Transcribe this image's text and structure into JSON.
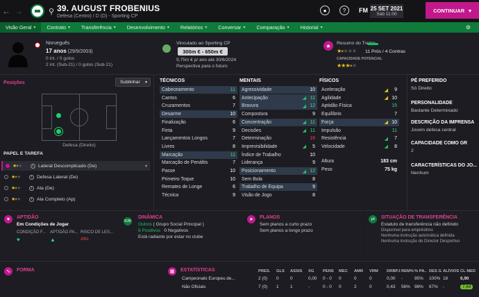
{
  "header": {
    "title": "39. AUGUST FROBENIUS",
    "subtitle": "Defesa (Centro) / D (D) - Sporting CP",
    "date": "25 SET 2021",
    "time": "Sáb 11:00",
    "continue": "CONTINUAR",
    "fm": "FM"
  },
  "tabs": [
    "Visão Geral",
    "Contrato",
    "Transferência",
    "Desenvolvimento",
    "Relatórios",
    "Conversar",
    "Comparação",
    "Historial"
  ],
  "profile": {
    "nationality": "Norueguês",
    "age": "17 anos",
    "dob": "(29/9/2003)",
    "caps1": "0 int. / 0 golos",
    "caps2": "2 int. (Sub-21) / 0 golos (Sub-21)"
  },
  "contract": {
    "label": "Vinculado ao Sporting CP",
    "value": "300m € - 650m €",
    "details": "9,75m € p/ ano até 30/6/2024",
    "perspective": "Perspectiva para o futuro"
  },
  "training": {
    "title": "Resumo do Treino",
    "pros": "11 Prós / 4 Contras",
    "cap_label": "CAPACIDADE POTENCIAL"
  },
  "positions": {
    "title": "Posições",
    "select": "Sublinhar",
    "pitch_label": "Defesa (Direito)"
  },
  "roles": {
    "title": "PAPEL E TAREFA",
    "items": [
      "Lateral Descomplicado (De)",
      "Defesa Lateral (De)",
      "Ala (De)",
      "Ala Completo (Ap)"
    ]
  },
  "tecnicos": {
    "title": "TÉCNICOS",
    "rows": [
      [
        "Cabeceamento",
        "11"
      ],
      [
        "Cantos",
        "6"
      ],
      [
        "Cruzamentos",
        "7"
      ],
      [
        "Desarme",
        "10"
      ],
      [
        "Finalização",
        "6"
      ],
      [
        "Finta",
        "9"
      ],
      [
        "Lançamentos Longos",
        "7"
      ],
      [
        "Livres",
        "8"
      ],
      [
        "Marcação",
        "11"
      ],
      [
        "Marcação de Penáltis",
        "7"
      ],
      [
        "Passe",
        "10"
      ],
      [
        "Primeiro Toque",
        "10"
      ],
      [
        "Remates de Longe",
        "6"
      ],
      [
        "Técnica",
        "9"
      ]
    ]
  },
  "mentais": {
    "title": "MENTAIS",
    "rows": [
      [
        "Agressividade",
        "10"
      ],
      [
        "Antecipação",
        "11"
      ],
      [
        "Bravura",
        "12"
      ],
      [
        "Compostura",
        "9"
      ],
      [
        "Concentração",
        "11"
      ],
      [
        "Decisões",
        "11"
      ],
      [
        "Determinação",
        "16"
      ],
      [
        "Imprevisibilidade",
        "5"
      ],
      [
        "Índice de Trabalho",
        "10"
      ],
      [
        "Liderança",
        "9"
      ],
      [
        "Posicionamento",
        "12"
      ],
      [
        "Sem Bola",
        "8"
      ],
      [
        "Trabalho de Equipa",
        "9"
      ],
      [
        "Visão de Jogo",
        "8"
      ]
    ]
  },
  "fisicos": {
    "title": "FÍSICOS",
    "rows": [
      [
        "Aceleração",
        "9"
      ],
      [
        "Agilidade",
        "10"
      ],
      [
        "Aptidão Física",
        "15"
      ],
      [
        "Equilíbrio",
        "7"
      ],
      [
        "Força",
        "10"
      ],
      [
        "Impulsão",
        "11"
      ],
      [
        "Resistência",
        "7"
      ],
      [
        "Velocidade",
        "8"
      ]
    ],
    "altura_l": "Altura",
    "altura": "183 cm",
    "peso_l": "Peso",
    "peso": "75 kg"
  },
  "info": [
    [
      "PÉ PREFERIDO",
      "Só Direito"
    ],
    [
      "PERSONALIDADE",
      "Bastante Determinado"
    ],
    [
      "DESCRIÇÃO DA IMPRENSA",
      "Jovem defesa central"
    ],
    [
      "CAPACIDADE COMO GR",
      "2"
    ],
    [
      "CARACTERÍSTICAS DO JO...",
      "Nenhum"
    ]
  ],
  "aptidao": {
    "title": "APTIDÃO",
    "status": "Em Condições de Jogar",
    "h1": "CONDIÇÃO F...",
    "h2": "APTIDÃO PA...",
    "h3": "RISCO DE LES...",
    "risk": "Alto"
  },
  "dinamica": {
    "title": "DINÂMICA",
    "line1a": "Outros",
    "line1b": "( Grupo Social Principal )",
    "pos": "6 Positivos",
    "neg": "0 Negativos",
    "line3": "Está radiante por estar no clube"
  },
  "planos": {
    "title": "PLANOS",
    "l1": "Sem planos a curto prazo",
    "l2": "Sem planos a longo prazo"
  },
  "transfer": {
    "title": "SITUAÇÃO DE TRANSFERÊNCIA",
    "l1": "Estatuto de transferência não definido",
    "l2": "Disponível para empréstimo",
    "l3": "Nenhuma instrução automática definida",
    "l4": "Nenhuma instrução do Director Desportivo"
  },
  "forma": {
    "title": "FORMA"
  },
  "stats": {
    "title": "ESTATÍSTICAS",
    "headers": [
      "PRES.",
      "GLS",
      "ASSIS",
      "XG",
      "PENS",
      "MEC",
      "AMR",
      "VRM",
      "DRBPJ",
      "REM%",
      "% PA..",
      "DES G",
      "ALÍVIOS",
      "CL MED"
    ],
    "rows": [
      {
        "name": "Campeonato Europeu de...",
        "vals": [
          "2 (0)",
          "0",
          "0",
          "0,00",
          "0 - 0",
          "0",
          "0",
          "0",
          "0,00",
          "-",
          "95%",
          "100%",
          "18",
          "6,90"
        ]
      },
      {
        "name": "Não Oficiais",
        "vals": [
          "7 (0)",
          "1",
          "1",
          "-",
          "0 - 0",
          "0",
          "2",
          "0",
          "0,43",
          "56%",
          "98%",
          "67%",
          "-",
          "7,64"
        ]
      }
    ]
  }
}
